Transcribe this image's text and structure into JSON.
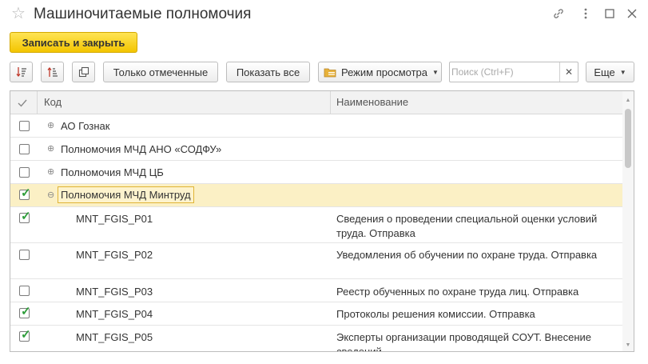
{
  "window": {
    "title": "Машиночитаемые полномочия"
  },
  "toolbar": {
    "save_close_label": "Записать и закрыть",
    "only_marked_label": "Только отмеченные",
    "show_all_label": "Показать все",
    "view_mode_label": "Режим просмотра",
    "search_placeholder": "Поиск (Ctrl+F)",
    "search_value": "",
    "more_label": "Еще"
  },
  "grid": {
    "columns": [
      "Код",
      "Наименование"
    ],
    "rows": [
      {
        "type": "group",
        "checked": false,
        "expanded": false,
        "code": "АО Гознак",
        "name": ""
      },
      {
        "type": "group",
        "checked": false,
        "expanded": false,
        "code": "Полномочия МЧД АНО «СОДФУ»",
        "name": ""
      },
      {
        "type": "group",
        "checked": false,
        "expanded": false,
        "code": "Полномочия МЧД ЦБ",
        "name": ""
      },
      {
        "type": "group",
        "checked": true,
        "expanded": true,
        "selected": true,
        "code": "Полномочия МЧД Минтруд",
        "name": ""
      },
      {
        "type": "item",
        "checked": true,
        "code": "MNT_FGIS_P01",
        "name": "Сведения о проведении специальной оценки условий труда. Отправка"
      },
      {
        "type": "item",
        "checked": false,
        "code": "MNT_FGIS_P02",
        "name": "Уведомления об обучении по охране труда. Отправка"
      },
      {
        "type": "item",
        "checked": false,
        "code": "MNT_FGIS_P03",
        "name": "Реестр обученных по охране труда лиц. Отправка"
      },
      {
        "type": "item",
        "checked": true,
        "code": "MNT_FGIS_P04",
        "name": "Протоколы решения комиссии. Отправка"
      },
      {
        "type": "item",
        "checked": true,
        "code": "MNT_FGIS_P05",
        "name": "Эксперты организации проводящей СОУТ. Внесение сведений"
      }
    ]
  }
}
